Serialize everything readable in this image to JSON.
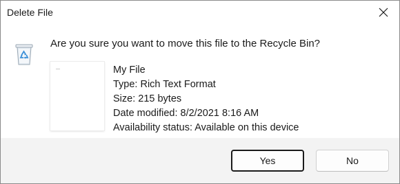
{
  "window": {
    "title": "Delete File",
    "close_icon": "close-icon"
  },
  "message": {
    "question": "Are you sure you want to move this file to the Recycle Bin?",
    "icon": "recycle-bin-icon"
  },
  "file": {
    "name": "My File",
    "type": "Type: Rich Text Format",
    "size": "Size: 215 bytes",
    "date_modified": "Date modified: 8/2/2021 8:16 AM",
    "availability": "Availability status: Available on this device"
  },
  "buttons": {
    "yes_label": "Yes",
    "no_label": "No"
  },
  "colors": {
    "footer_bg": "#f3f3f3",
    "recycle_blue": "#3a8fd8"
  }
}
